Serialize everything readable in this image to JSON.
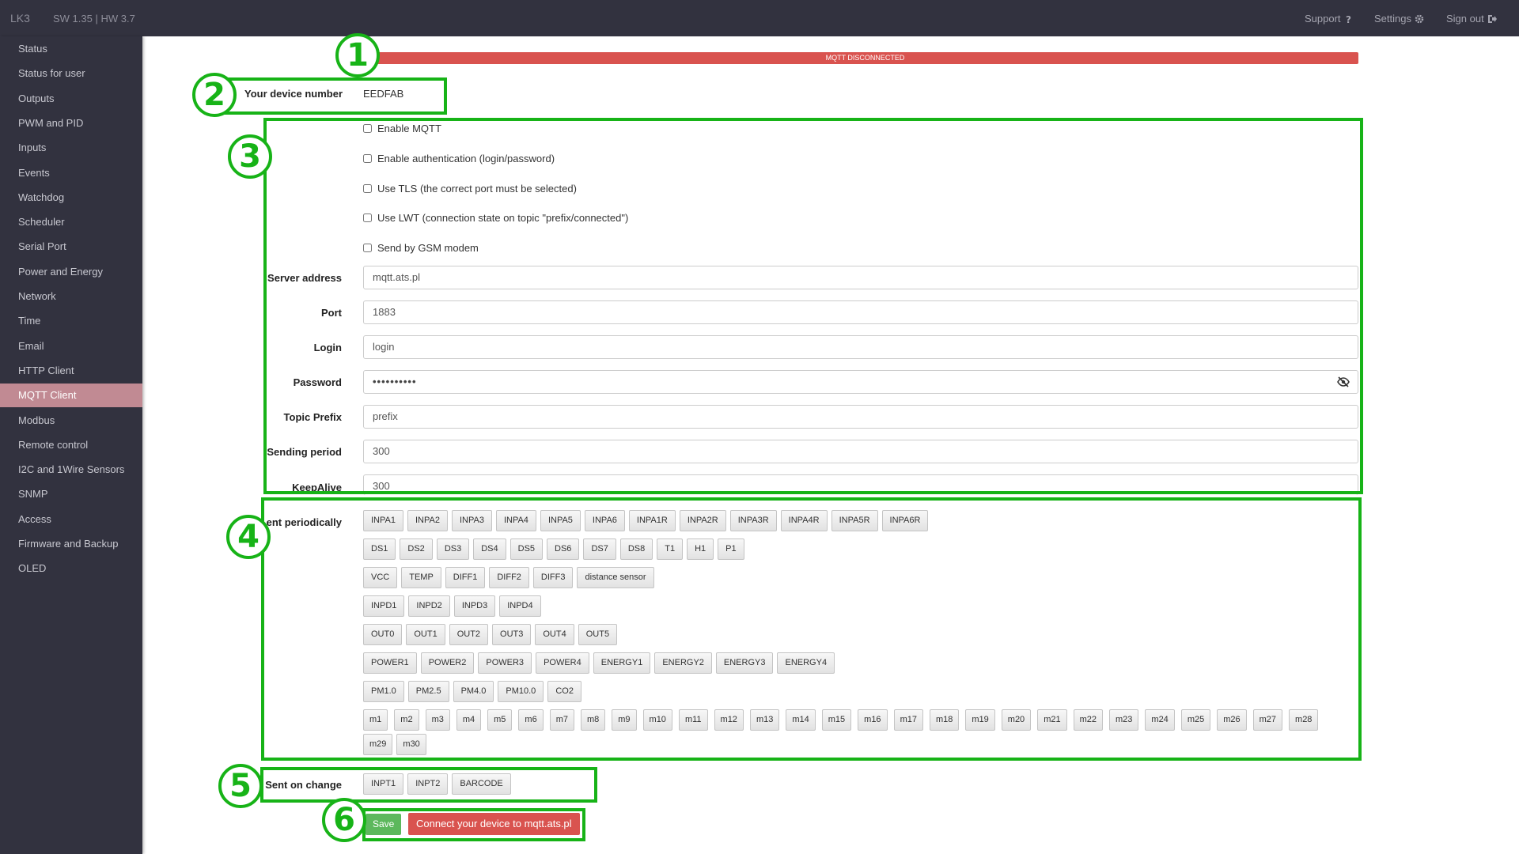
{
  "topbar": {
    "brand": "LK3",
    "version": "SW 1.35 | HW 3.7",
    "support": "Support",
    "settings": "Settings",
    "signout": "Sign out"
  },
  "sidebar": {
    "items": [
      {
        "label": "Status"
      },
      {
        "label": "Status for user"
      },
      {
        "label": "Outputs"
      },
      {
        "label": "PWM and PID"
      },
      {
        "label": "Inputs"
      },
      {
        "label": "Events"
      },
      {
        "label": "Watchdog"
      },
      {
        "label": "Scheduler"
      },
      {
        "label": "Serial Port"
      },
      {
        "label": "Power and Energy"
      },
      {
        "label": "Network"
      },
      {
        "label": "Time"
      },
      {
        "label": "Email"
      },
      {
        "label": "HTTP Client"
      },
      {
        "label": "MQTT Client",
        "active": true
      },
      {
        "label": "Modbus"
      },
      {
        "label": "Remote control"
      },
      {
        "label": "I2C and 1Wire Sensors"
      },
      {
        "label": "SNMP"
      },
      {
        "label": "Access"
      },
      {
        "label": "Firmware and Backup"
      },
      {
        "label": "OLED"
      }
    ]
  },
  "status": "MQTT DISCONNECTED",
  "device": {
    "label": "Your device number",
    "value": "EEDFAB"
  },
  "checkboxes": [
    "Enable MQTT",
    "Enable authentication (login/password)",
    "Use TLS (the correct port must be selected)",
    "Use LWT (connection state on topic \"prefix/connected\")",
    "Send by GSM modem"
  ],
  "fields": {
    "server": {
      "label": "Server address",
      "value": "mqtt.ats.pl"
    },
    "port": {
      "label": "Port",
      "value": "1883"
    },
    "login": {
      "label": "Login",
      "value": "login"
    },
    "password": {
      "label": "Password",
      "value": "••••••••••"
    },
    "prefix": {
      "label": "Topic Prefix",
      "value": "prefix"
    },
    "period": {
      "label": "Sending period",
      "value": "300"
    },
    "keepalive": {
      "label": "KeepAlive",
      "value": "300"
    }
  },
  "periodic_label": "ent periodically",
  "periodic_rows": [
    [
      "INPA1",
      "INPA2",
      "INPA3",
      "INPA4",
      "INPA5",
      "INPA6",
      "INPA1R",
      "INPA2R",
      "INPA3R",
      "INPA4R",
      "INPA5R",
      "INPA6R"
    ],
    [
      "DS1",
      "DS2",
      "DS3",
      "DS4",
      "DS5",
      "DS6",
      "DS7",
      "DS8",
      "T1",
      "H1",
      "P1"
    ],
    [
      "VCC",
      "TEMP",
      "DIFF1",
      "DIFF2",
      "DIFF3",
      "distance sensor"
    ],
    [
      "INPD1",
      "INPD2",
      "INPD3",
      "INPD4"
    ],
    [
      "OUT0",
      "OUT1",
      "OUT2",
      "OUT3",
      "OUT4",
      "OUT5"
    ],
    [
      "POWER1",
      "POWER2",
      "POWER3",
      "POWER4",
      "ENERGY1",
      "ENERGY2",
      "ENERGY3",
      "ENERGY4"
    ],
    [
      "PM1.0",
      "PM2.5",
      "PM4.0",
      "PM10.0",
      "CO2"
    ],
    [
      "m1",
      "m2",
      "m3",
      "m4",
      "m5",
      "m6",
      "m7",
      "m8",
      "m9",
      "m10",
      "m11",
      "m12",
      "m13",
      "m14",
      "m15",
      "m16",
      "m17",
      "m18",
      "m19",
      "m20",
      "m21",
      "m22",
      "m23",
      "m24",
      "m25",
      "m26",
      "m27",
      "m28"
    ],
    [
      "m29",
      "m30"
    ]
  ],
  "change_label": "Sent on change",
  "change_tags": [
    "INPT1",
    "INPT2",
    "BARCODE"
  ],
  "buttons": {
    "save": "Save",
    "connect": "Connect your device to mqtt.ats.pl"
  },
  "annotations": [
    "1",
    "2",
    "3",
    "4",
    "5",
    "6"
  ]
}
